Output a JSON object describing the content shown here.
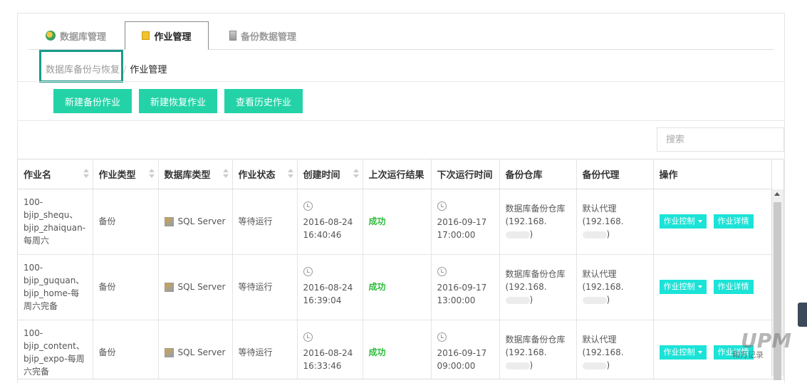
{
  "tabs": [
    {
      "label": "数据库管理",
      "icon": "database-icon"
    },
    {
      "label": "作业管理",
      "icon": "job-icon"
    },
    {
      "label": "备份数据管理",
      "icon": "backup-icon"
    }
  ],
  "breadcrumb": {
    "parent": "数据库备份与恢复",
    "separator": "/",
    "current": "作业管理"
  },
  "toolbar": {
    "new_backup": "新建备份作业",
    "new_restore": "新建恢复作业",
    "history": "查看历史作业"
  },
  "search": {
    "placeholder": "搜索"
  },
  "table": {
    "columns": [
      "作业名",
      "作业类型",
      "数据库类型",
      "作业状态",
      "创建时间",
      "上次运行结果",
      "下次运行时间",
      "备份仓库",
      "备份代理",
      "操作"
    ],
    "rows": [
      {
        "name": "100-bjip_shequ、bjip_zhaiquan-每周六",
        "type": "备份",
        "db_type": "SQL Server",
        "status": "等待运行",
        "created_date": "2016-08-24",
        "created_time": "16:40:46",
        "last_result": "成功",
        "next_date": "2016-09-17",
        "next_time": "17:00:00",
        "repo": "数据库备份仓库",
        "repo_ip": "(192.168.",
        "repo_end": ")",
        "agent": "默认代理",
        "agent_ip": "(192.168.",
        "agent_end": ")",
        "ctrl": "作业控制",
        "detail": "作业详情"
      },
      {
        "name": "100-bjip_guquan、bjip_home-每周六完备",
        "type": "备份",
        "db_type": "SQL Server",
        "status": "等待运行",
        "created_date": "2016-08-24",
        "created_time": "16:39:04",
        "last_result": "成功",
        "next_date": "2016-09-17",
        "next_time": "13:00:00",
        "repo": "数据库备份仓库",
        "repo_ip": "(192.168.",
        "repo_end": ")",
        "agent": "默认代理",
        "agent_ip": "(192.168.",
        "agent_end": ")",
        "ctrl": "作业控制",
        "detail": "作业详情"
      },
      {
        "name": "100-bjip_content、bjip_expo-每周六完备",
        "type": "备份",
        "db_type": "SQL Server",
        "status": "等待运行",
        "created_date": "2016-08-24",
        "created_time": "16:33:46",
        "last_result": "成功",
        "next_date": "2016-09-17",
        "next_time": "09:00:00",
        "repo": "数据库备份仓库",
        "repo_ip": "(192.168.",
        "repo_end": ")",
        "agent": "默认代理",
        "agent_ip": "(192.168.",
        "agent_end": ")",
        "ctrl": "作业控制",
        "detail": "作业详情"
      }
    ]
  },
  "watermark": {
    "logo": "UPM",
    "text": "和万记录"
  },
  "colors": {
    "accent": "#23d3a7",
    "op_button": "#1be3d7",
    "success": "#2dbb3a",
    "highlight_box": "#1a9a8a"
  }
}
